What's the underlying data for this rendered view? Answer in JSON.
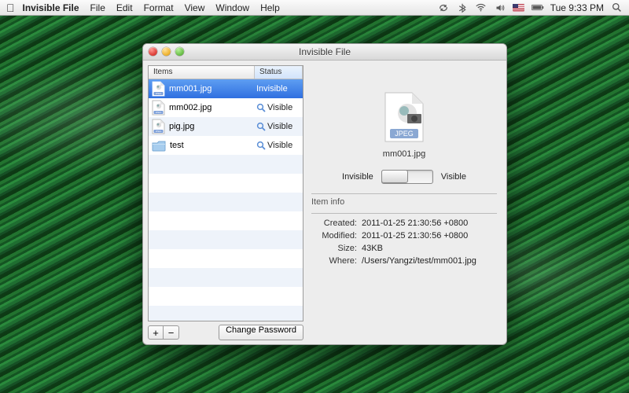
{
  "menubar": {
    "app_name": "Invisible File",
    "items": [
      "File",
      "Edit",
      "Format",
      "View",
      "Window",
      "Help"
    ],
    "clock": "Tue 9:33 PM"
  },
  "window": {
    "title": "Invisible File"
  },
  "table": {
    "headers": {
      "items": "Items",
      "status": "Status"
    },
    "rows": [
      {
        "name": "mm001.jpg",
        "type": "jpeg",
        "status": "Invisible",
        "selected": true
      },
      {
        "name": "mm002.jpg",
        "type": "jpeg",
        "status": "Visible",
        "selected": false
      },
      {
        "name": "pig.jpg",
        "type": "jpeg",
        "status": "Visible",
        "selected": false
      },
      {
        "name": "test",
        "type": "folder",
        "status": "Visible",
        "selected": false
      }
    ]
  },
  "footer": {
    "add": "+",
    "remove": "−",
    "change_password": "Change Password"
  },
  "preview": {
    "name": "mm001.jpg",
    "type_label": "JPEG"
  },
  "toggle": {
    "left": "Invisible",
    "right": "Visible",
    "state": "invisible"
  },
  "info": {
    "title": "Item info",
    "labels": {
      "created": "Created:",
      "modified": "Modified:",
      "size": "Size:",
      "where": "Where:"
    },
    "created": "2011-01-25 21:30:56 +0800",
    "modified": "2011-01-25 21:30:56 +0800",
    "size": "43KB",
    "where": "/Users/Yangzi/test/mm001.jpg"
  }
}
